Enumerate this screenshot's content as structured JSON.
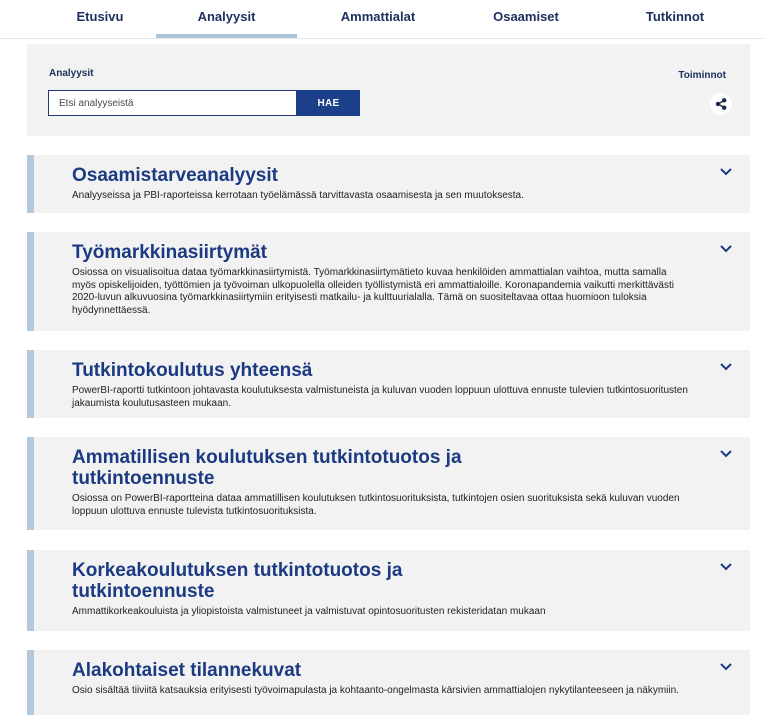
{
  "nav": {
    "tabs": [
      {
        "label": "Etusivu"
      },
      {
        "label": "Analyysit",
        "active": true
      },
      {
        "label": "Ammattialat"
      },
      {
        "label": "Osaamiset"
      },
      {
        "label": "Tutkinnot"
      }
    ]
  },
  "search": {
    "title": "Analyysit",
    "placeholder": "Etsi analyyseistä",
    "button_label": "HAE",
    "tools_label": "Toiminnot",
    "share_icon": "share-icon"
  },
  "colors": {
    "accent": "#1c3f8a",
    "card_border": "#b6c9da",
    "card_bg": "#f2f2f2",
    "heading": "#1c3a82"
  },
  "cards": [
    {
      "title": "Osaamistarveanalyysit",
      "description": "Analyyseissa ja PBI-raporteissa kerrotaan työelämässä tarvittavasta osaamisesta ja sen muutoksesta."
    },
    {
      "title": "Työmarkkinasiirtymät",
      "description": "Osiossa on visualisoitua dataa työmarkkinasiirtymistä. Työmarkkinasiirtymätieto kuvaa henkilöiden ammattialan vaihtoa, mutta samalla myös opiskelijoiden, työttömien ja työvoiman ulkopuolella olleiden työllistymistä eri ammattialoille. Koronapandemia vaikutti merkittävästi 2020-luvun alkuvuosina työmarkkinasiirtymiin erityisesti matkailu- ja kulttuurialalla. Tämä on suositeltavaa ottaa huomioon tuloksia hyödynnettäessä."
    },
    {
      "title": "Tutkintokoulutus yhteensä",
      "description": "PowerBI-raportti tutkintoon johtavasta koulutuksesta valmistuneista ja kuluvan vuoden loppuun ulottuva ennuste tulevien tutkintosuoritusten jakaumista koulutusasteen mukaan."
    },
    {
      "title": "Ammatillisen koulutuksen tutkintotuotos ja tutkintoennuste",
      "description": "Osiossa on PowerBI-raportteina dataa ammatillisen koulutuksen tutkintosuorituksista, tutkintojen osien suorituksista sekä kuluvan vuoden loppuun ulottuva ennuste tulevista tutkintosuorituksista."
    },
    {
      "title": "Korkeakoulutuksen tutkintotuotos ja tutkintoennuste",
      "description": "Ammattikorkeakouluista ja yliopistoista valmistuneet ja valmistuvat opintosuoritusten rekisteridatan mukaan"
    },
    {
      "title": "Alakohtaiset tilannekuvat",
      "description": "Osio sisältää tiiviitä katsauksia erityisesti työvoimapulasta ja kohtaanto-ongelmasta kärsivien ammattialojen nykytilanteeseen ja näkymiin."
    }
  ]
}
